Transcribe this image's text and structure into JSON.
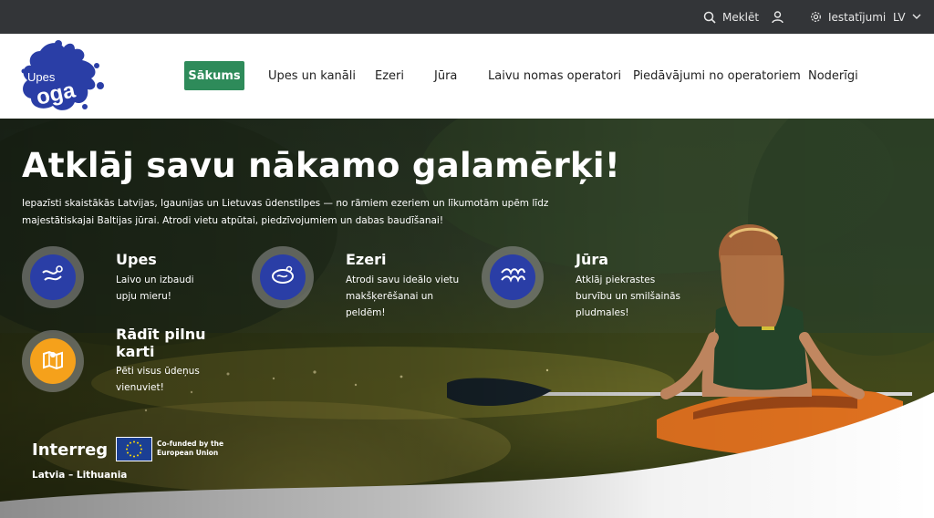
{
  "topbar": {
    "search_label": "Meklēt",
    "settings_label": "Iestatījumi",
    "language": "LV"
  },
  "logo": {
    "line1": "Upes",
    "line2": "oga"
  },
  "nav": {
    "items": [
      {
        "label": "Sākums",
        "active": true
      },
      {
        "label": "Upes un kanāli"
      },
      {
        "label": "Ezeri"
      },
      {
        "label": "Jūra"
      },
      {
        "label": "Laivu nomas operatori"
      },
      {
        "label": "Piedāvājumi no operatoriem"
      },
      {
        "label": "Noderīgi"
      }
    ]
  },
  "hero": {
    "title": "Atklāj savu nākamo galamērķi!",
    "subtitle": "Iepazīsti skaistākās Latvijas, Igaunijas un Lietuvas ūdenstilpes — no rāmiem ezeriem un līkumotām upēm līdz majestātiskajai Baltijas jūrai. Atrodi vietu atpūtai, piedzīvojumiem un dabas baudīšanai!",
    "cards": [
      {
        "title": "Upes",
        "description": "Laivo un izbaudi upju mieru!",
        "icon": "river-icon"
      },
      {
        "title": "Ezeri",
        "description": "Atrodi savu ideālo vietu makšķerēšanai un peldēm!",
        "icon": "lake-icon"
      },
      {
        "title": "Jūra",
        "description": "Atklāj piekrastes burvību un smilšainās pludmales!",
        "icon": "sea-waves-icon"
      },
      {
        "title": "Rādīt pilnu karti",
        "description": "Pēti visus ūdeņus vienuviet!",
        "icon": "map-icon"
      }
    ]
  },
  "funding": {
    "program": "Interreg",
    "eu_text": "Co-funded by the European Union",
    "region": "Latvia – Lithuania"
  },
  "colors": {
    "accent_green": "#2e8b5a",
    "brand_blue": "#2a3ea6",
    "map_orange": "#f5a11b",
    "topbar": "#333538"
  }
}
